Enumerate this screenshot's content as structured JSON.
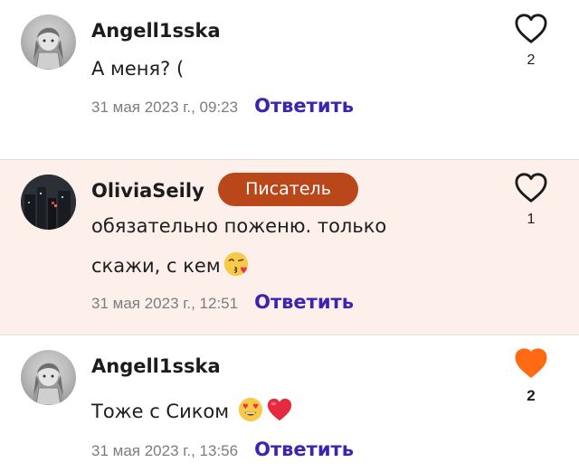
{
  "comments": [
    {
      "author": "Angell1sska",
      "text": "А меня? (",
      "date": "31 мая 2023 г., 09:23",
      "reply_label": "Ответить",
      "likes": "2",
      "liked": false,
      "avatar": "anime-avatar"
    },
    {
      "author": "OliviaSeily",
      "badge": "Писатель",
      "text": "обязательно поженю. только скажи, с кем",
      "emoji": [
        "kissing-face-emoji"
      ],
      "date": "31 мая 2023 г., 12:51",
      "reply_label": "Ответить",
      "likes": "1",
      "liked": false,
      "avatar": "night-city-avatar"
    },
    {
      "author": "Angell1sska",
      "text": "Тоже с Сиком",
      "emoji": [
        "heart-eyes-emoji",
        "red-heart-emoji"
      ],
      "date": "31 мая 2023 г., 13:56",
      "reply_label": "Ответить",
      "likes": "2",
      "liked": true,
      "avatar": "anime-avatar"
    }
  ],
  "colors": {
    "highlight_bg": "#fdf0ea",
    "badge_bg": "#b9471a",
    "reply_link": "#3d23b0",
    "liked_heart": "#ff6a13",
    "muted_text": "#7d7d7d"
  }
}
